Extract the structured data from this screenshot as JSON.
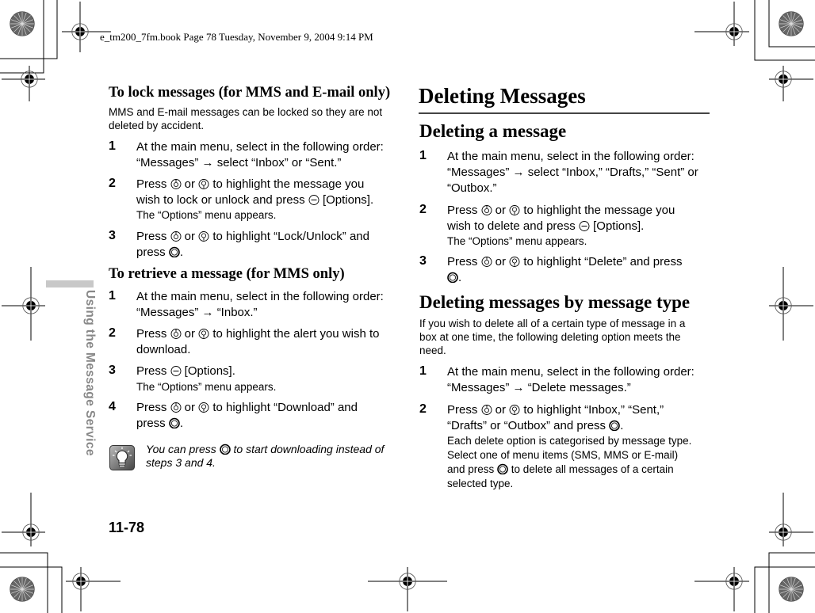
{
  "header": {
    "file_info": "e_tm200_7fm.book  Page 78  Tuesday, November 9, 2004  9:14 PM"
  },
  "sidebar": {
    "section_title": "Using the Message Service"
  },
  "footer": {
    "page_number": "11-78"
  },
  "left_column": {
    "lock": {
      "heading": "To lock messages (for MMS and E-mail only)",
      "intro_line1": "MMS and E-mail messages can be locked so they are not",
      "intro_line2": "deleted by accident.",
      "steps": [
        {
          "num": "1",
          "line1": "At the main menu, select in the following order:",
          "line2": "“Messages” → select “Inbox” or “Sent.”"
        },
        {
          "num": "2",
          "line1a": "Press ",
          "line1b": " or ",
          "line1c": " to highlight the message you",
          "line2a": "wish to lock or unlock and press ",
          "line2b": " [Options].",
          "note": "The “Options” menu appears."
        },
        {
          "num": "3",
          "line1a": "Press ",
          "line1b": " or ",
          "line1c": " to highlight “Lock/Unlock” and",
          "line2a": "press ",
          "line2b": "."
        }
      ]
    },
    "retrieve": {
      "heading": "To retrieve a message (for MMS only)",
      "steps": [
        {
          "num": "1",
          "line1": "At the main menu, select in the following order:",
          "line2": "“Messages” → “Inbox.”"
        },
        {
          "num": "2",
          "line1a": "Press ",
          "line1b": " or ",
          "line1c": " to highlight the alert you wish to",
          "line2": "download."
        },
        {
          "num": "3",
          "line1a": "Press ",
          "line1b": " [Options].",
          "note": "The “Options” menu appears."
        },
        {
          "num": "4",
          "line1a": "Press ",
          "line1b": " or ",
          "line1c": " to highlight “Download” and",
          "line2a": "press ",
          "line2b": "."
        }
      ],
      "tip": {
        "line1a": "You can press ",
        "line1b": " to start downloading instead of",
        "line2": "steps 3 and 4."
      }
    }
  },
  "right_column": {
    "title": "Deleting Messages",
    "delete_one": {
      "heading": "Deleting a message",
      "steps": [
        {
          "num": "1",
          "line1": "At the main menu, select in the following order:",
          "line2": "“Messages” → select “Inbox,” “Drafts,” “Sent” or",
          "line3": "“Outbox.”"
        },
        {
          "num": "2",
          "line1a": "Press ",
          "line1b": " or ",
          "line1c": " to highlight the message you",
          "line2a": "wish to delete and press ",
          "line2b": " [Options].",
          "note": "The “Options” menu appears."
        },
        {
          "num": "3",
          "line1a": "Press ",
          "line1b": " or ",
          "line1c": " to highlight “Delete” and press",
          "line2b": "."
        }
      ]
    },
    "delete_type": {
      "heading": "Deleting messages by message type",
      "intro_line1": "If you wish to delete all of a certain type of message in a",
      "intro_line2": "box at one time, the following deleting option meets the",
      "intro_line3": "need.",
      "steps": [
        {
          "num": "1",
          "line1": "At the main menu, select in the following order:",
          "line2": "“Messages” → “Delete messages.”"
        },
        {
          "num": "2",
          "line1a": "Press ",
          "line1b": " or ",
          "line1c": " to highlight “Inbox,” “Sent,”",
          "line2a": "“Drafts” or “Outbox” and press ",
          "line2b": ".",
          "note1": "Each delete option is categorised by message type.",
          "note2": "Select one of menu items (SMS, MMS or E-mail)",
          "note3a": "and press ",
          "note3b": " to delete all messages of a certain",
          "note4": "selected type."
        }
      ]
    }
  },
  "icons": {
    "key_up": "nav-up-key-icon",
    "key_down": "nav-down-key-icon",
    "key_options": "left-soft-key-icon",
    "key_center": "center-key-icon",
    "tip": "lightbulb-tip-icon"
  }
}
